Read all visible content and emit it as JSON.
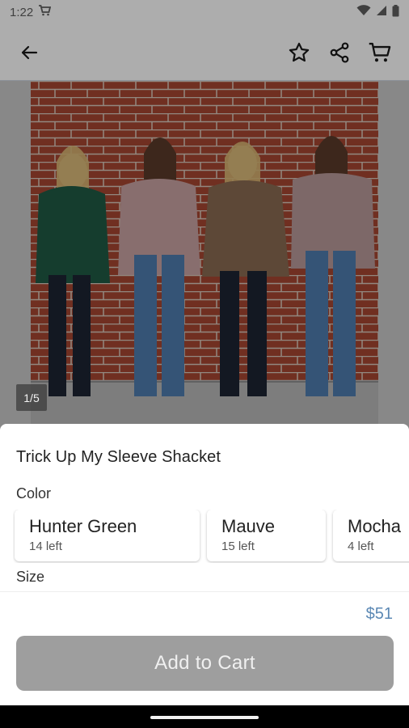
{
  "status_bar": {
    "time": "1:22",
    "icons": [
      "shopping-cart-icon",
      "wifi-icon",
      "cellular-signal-icon",
      "battery-icon"
    ]
  },
  "app_bar": {
    "icons": [
      "arrow-left-icon",
      "star-outline-icon",
      "share-icon",
      "cart-icon"
    ]
  },
  "gallery": {
    "page_indicator": "1/5",
    "current_page": 1,
    "total_pages": 5
  },
  "product": {
    "title": "Trick Up My Sleeve Shacket",
    "color_label": "Color",
    "size_label": "Size",
    "colors": [
      {
        "name": "Hunter Green",
        "stock": "14 left"
      },
      {
        "name": "Mauve",
        "stock": "15 left"
      },
      {
        "name": "Mocha",
        "stock": "4 left"
      }
    ],
    "price": "$51",
    "add_to_cart_label": "Add to Cart"
  },
  "colors": {
    "accent_price": "#5b88b4",
    "button_disabled": "#9e9e9e",
    "brick": "#9a3f2c",
    "hunter_green": "#1f5a45",
    "mauve": "#c9a3a3",
    "mocha": "#8a6a52"
  }
}
